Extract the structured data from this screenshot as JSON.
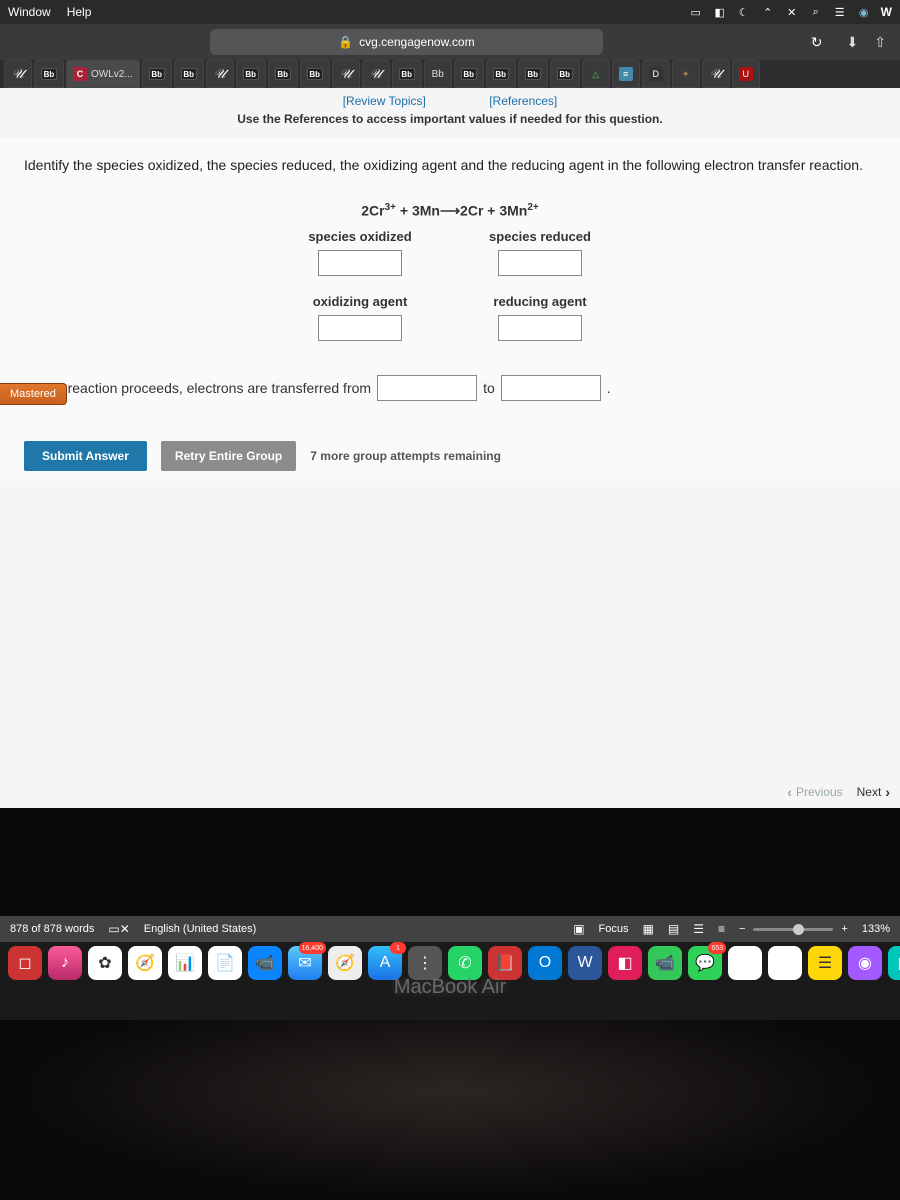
{
  "menubar": {
    "items": [
      "Window",
      "Help"
    ],
    "right_w": "W"
  },
  "browser": {
    "url": "cvg.cengagenow.com",
    "active_tab_label": "OWLv2...",
    "bb_tab_label": "Bb"
  },
  "page": {
    "link_review": "[Review Topics]",
    "link_references": "[References]",
    "ref_note": "Use the References to access important values if needed for this question.",
    "prompt": "Identify the species oxidized, the species reduced, the oxidizing agent and the reducing agent in the following electron transfer reaction.",
    "equation_html": "2Cr³⁺ + 3Mn ⟶ 2Cr + 3Mn²⁺",
    "label_oxidized": "species oxidized",
    "label_reduced": "species reduced",
    "label_oxidizing_agent": "oxidizing agent",
    "label_reducing_agent": "reducing agent",
    "mastered": "Mastered",
    "sentence_prefix": "As the reaction proceeds, electrons are transferred from",
    "sentence_mid": "to",
    "sentence_suffix": ".",
    "btn_submit": "Submit Answer",
    "btn_retry": "Retry Entire Group",
    "attempts": "7 more group attempts remaining",
    "nav_prev": "Previous",
    "nav_next": "Next"
  },
  "word_status": {
    "word_count": "878 of 878 words",
    "language": "English (United States)",
    "focus": "Focus",
    "zoom": "133%"
  },
  "dock": {
    "mail_badge": "16,400",
    "appstore_badge": "1",
    "msg_badge": "653"
  },
  "laptop_label": "MacBook Air"
}
